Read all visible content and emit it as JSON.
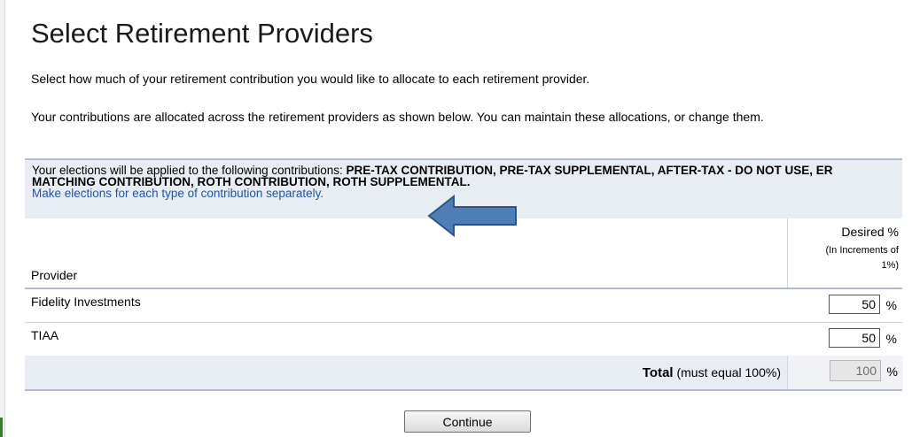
{
  "page": {
    "title": "Select Retirement Providers",
    "intro": "Select how much of your retirement contribution you would like to allocate to each retirement provider.",
    "explanation": "Your contributions are allocated across the retirement providers as shown below. You can maintain these allocations, or change them."
  },
  "notice": {
    "prefix": "Your elections will be applied to the following contributions: ",
    "contributions": "PRE-TAX CONTRIBUTION, PRE-TAX SUPPLEMENTAL, AFTER-TAX - DO NOT USE, ER MATCHING CONTRIBUTION, ROTH CONTRIBUTION, ROTH SUPPLEMENTAL",
    "suffix": ".",
    "link": "Make elections for each type of contribution separately."
  },
  "annotation": {
    "icon": "arrow-left-icon",
    "color": "#4a76ad"
  },
  "table": {
    "provider_header": "Provider",
    "desired_header": "Desired %",
    "increment_note": "(In Increments of 1%)",
    "rows": [
      {
        "name": "Fidelity Investments",
        "value": "50",
        "unit": "%"
      },
      {
        "name": "TIAA",
        "value": "50",
        "unit": "%"
      }
    ],
    "total": {
      "label": "Total",
      "note": " (must equal 100%)",
      "value": "100",
      "unit": "%"
    }
  },
  "actions": {
    "continue_label": "Continue"
  }
}
